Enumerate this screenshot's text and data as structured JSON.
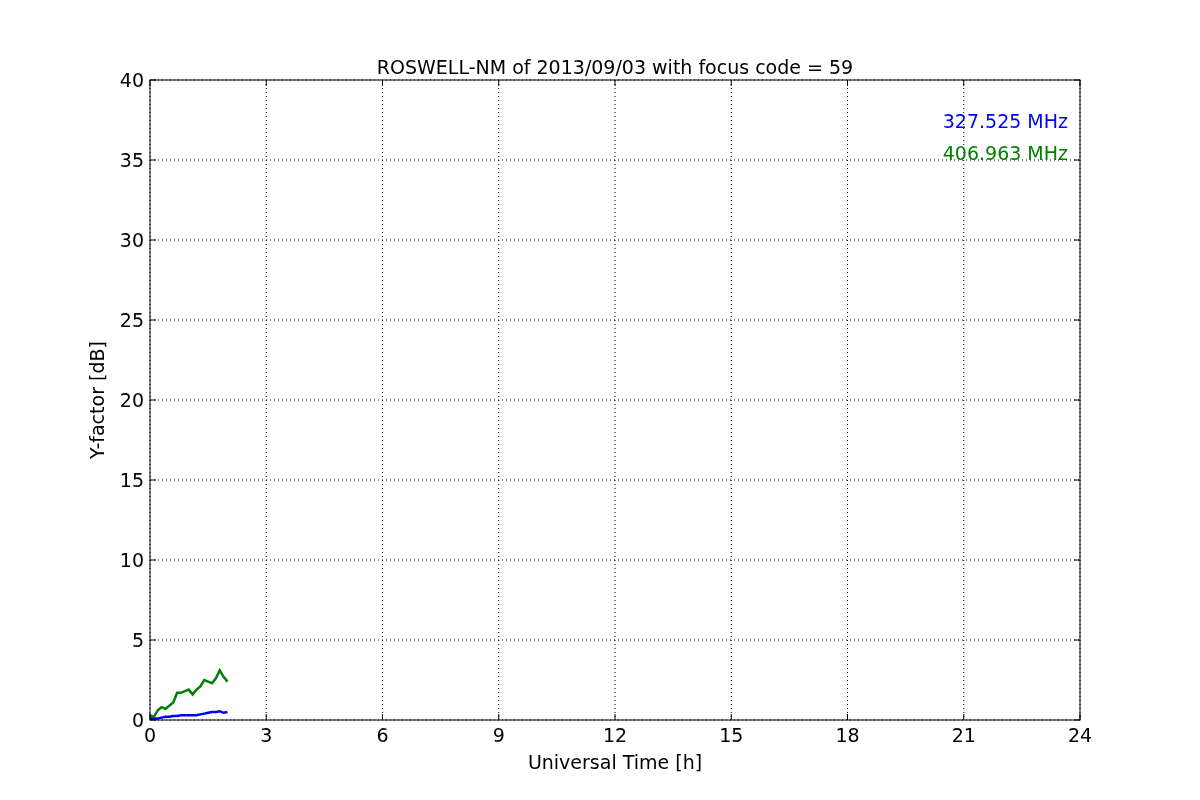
{
  "chart_data": {
    "type": "line",
    "title": "ROSWELL-NM of 2013/09/03 with focus code = 59",
    "xlabel": "Universal Time [h]",
    "ylabel": "Y-factor [dB]",
    "x": [
      0,
      0.1,
      0.2,
      0.3,
      0.4,
      0.5,
      0.6,
      0.7,
      0.8,
      0.9,
      1.0,
      1.1,
      1.2,
      1.3,
      1.4,
      1.5,
      1.6,
      1.7,
      1.8,
      1.9,
      2.0
    ],
    "series": [
      {
        "name": "327.525 MHz",
        "color": "#0000ff",
        "values": [
          0.1,
          0.1,
          0.1,
          0.15,
          0.2,
          0.2,
          0.25,
          0.25,
          0.3,
          0.3,
          0.3,
          0.3,
          0.3,
          0.35,
          0.4,
          0.45,
          0.5,
          0.5,
          0.55,
          0.45,
          0.5
        ]
      },
      {
        "name": "406.963 MHz",
        "color": "#008000",
        "values": [
          0.3,
          0.2,
          0.6,
          0.8,
          0.7,
          0.9,
          1.1,
          1.7,
          1.7,
          1.8,
          1.9,
          1.6,
          1.9,
          2.1,
          2.5,
          2.4,
          2.3,
          2.6,
          3.1,
          2.7,
          2.4
        ]
      }
    ],
    "xlim": [
      0,
      24
    ],
    "ylim": [
      0,
      40
    ],
    "xticks": [
      0,
      3,
      6,
      9,
      12,
      15,
      18,
      21,
      24
    ],
    "yticks": [
      0,
      5,
      10,
      15,
      20,
      25,
      30,
      35,
      40
    ],
    "grid": true
  }
}
